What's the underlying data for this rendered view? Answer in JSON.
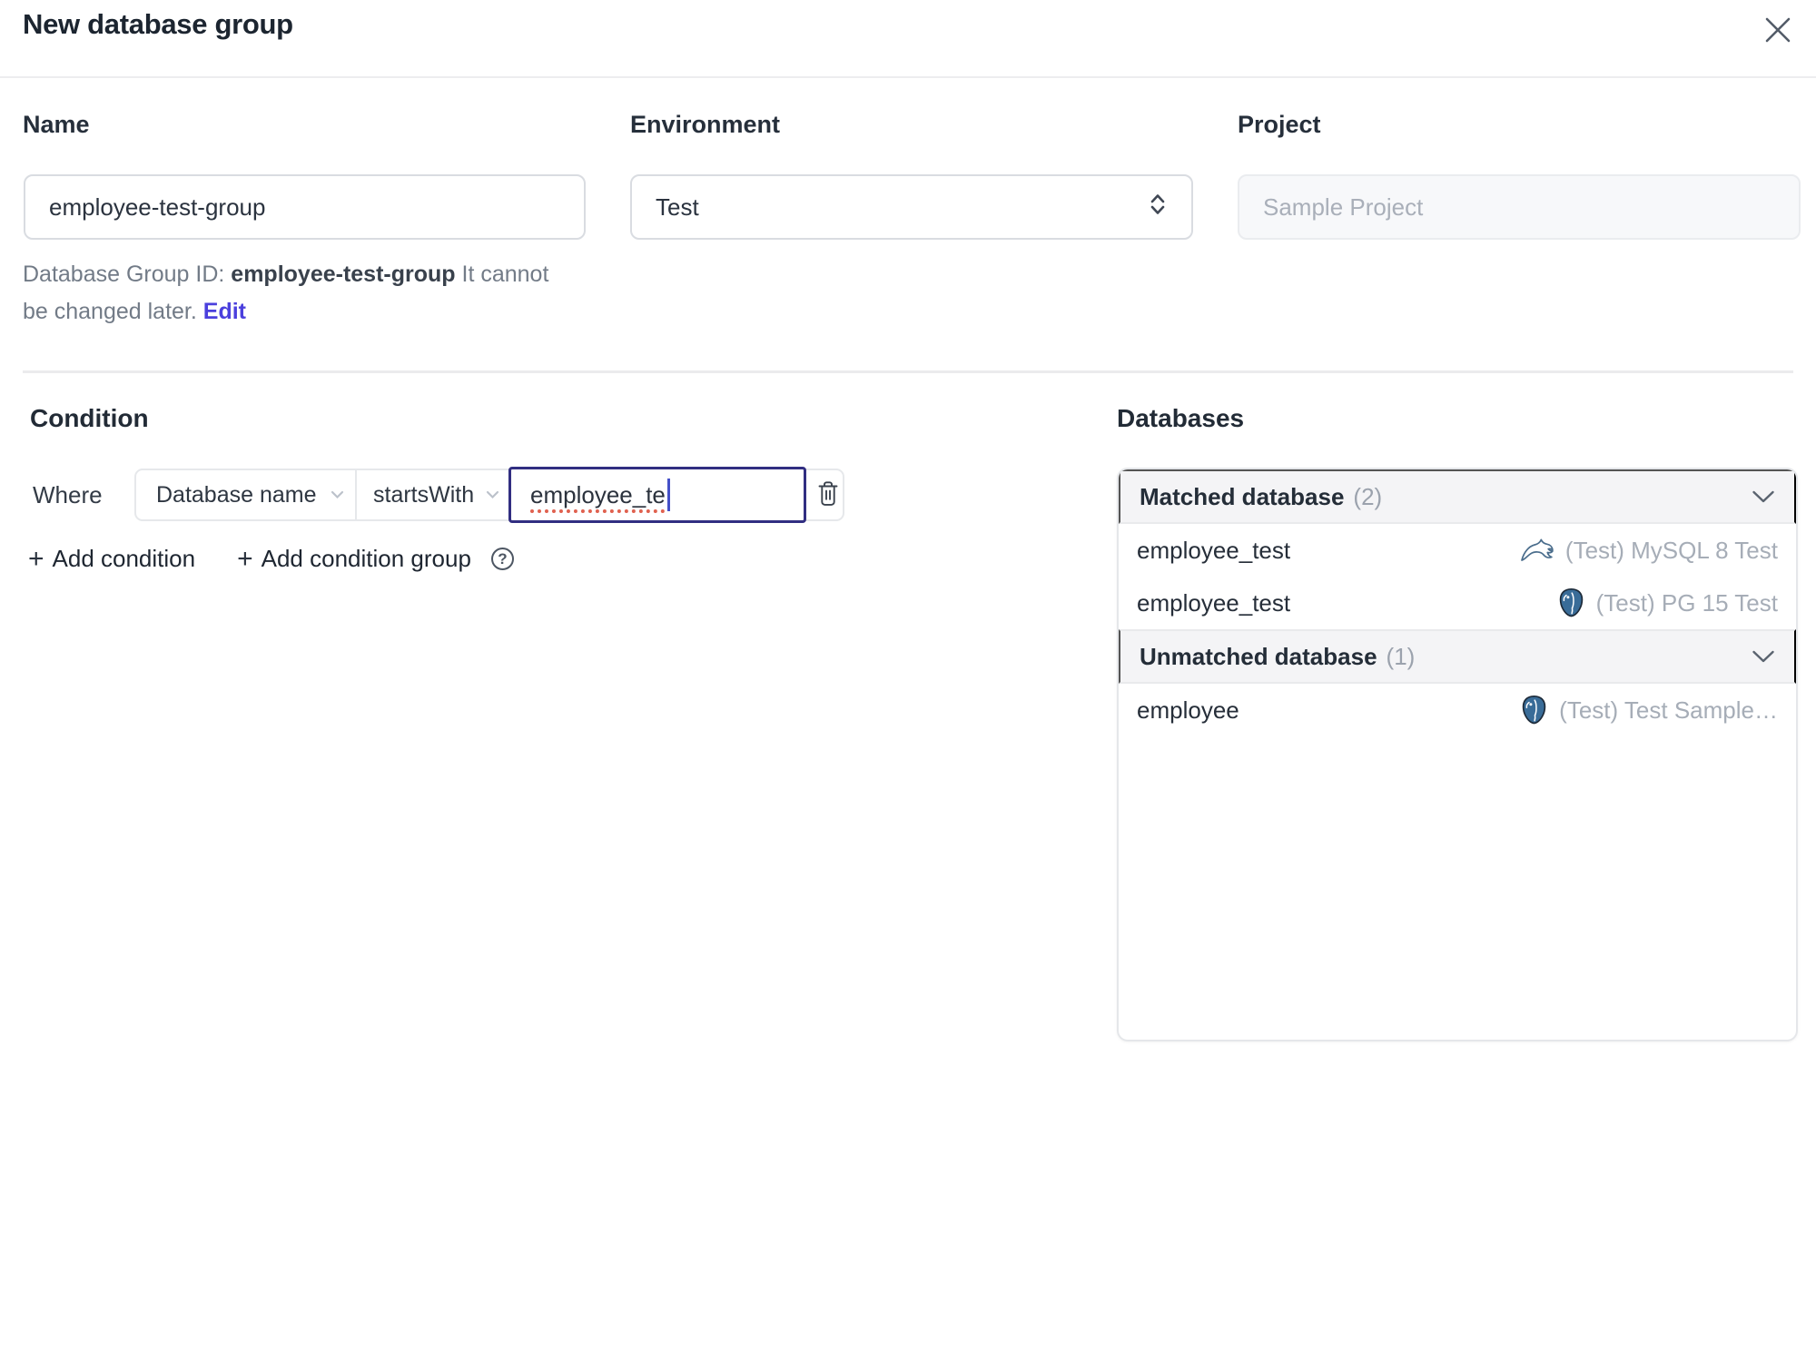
{
  "dialog": {
    "title": "New database group"
  },
  "form": {
    "name": {
      "label": "Name",
      "value": "employee-test-group"
    },
    "environment": {
      "label": "Environment",
      "value": "Test"
    },
    "project": {
      "label": "Project",
      "value": "Sample Project"
    },
    "group_id": {
      "prefix": "Database Group ID: ",
      "value": "employee-test-group",
      "note": " It cannot be changed later. ",
      "edit_label": "Edit"
    }
  },
  "condition": {
    "heading": "Condition",
    "where_label": "Where",
    "factor": "Database name",
    "operator": "startsWith",
    "value": "employee_te",
    "plus": "+",
    "add_condition": "Add condition",
    "add_condition_group": "Add condition group",
    "help": "?"
  },
  "databases": {
    "heading": "Databases",
    "matched": {
      "title": "Matched database",
      "count": "(2)",
      "rows": [
        {
          "name": "employee_test",
          "engine": "mysql",
          "instance": "(Test) MySQL 8 Test"
        },
        {
          "name": "employee_test",
          "engine": "postgresql",
          "instance": "(Test) PG 15 Test"
        }
      ]
    },
    "unmatched": {
      "title": "Unmatched database",
      "count": "(1)",
      "rows": [
        {
          "name": "employee",
          "engine": "postgresql",
          "instance": "(Test) Test Sample…"
        }
      ]
    }
  },
  "colors": {
    "accent": "#4b40dd",
    "focus_border": "#312e81",
    "spellcheck_underline": "#e0614f",
    "mysql_icon": "#4a6d8c",
    "postgresql_icon": "#396c98"
  }
}
